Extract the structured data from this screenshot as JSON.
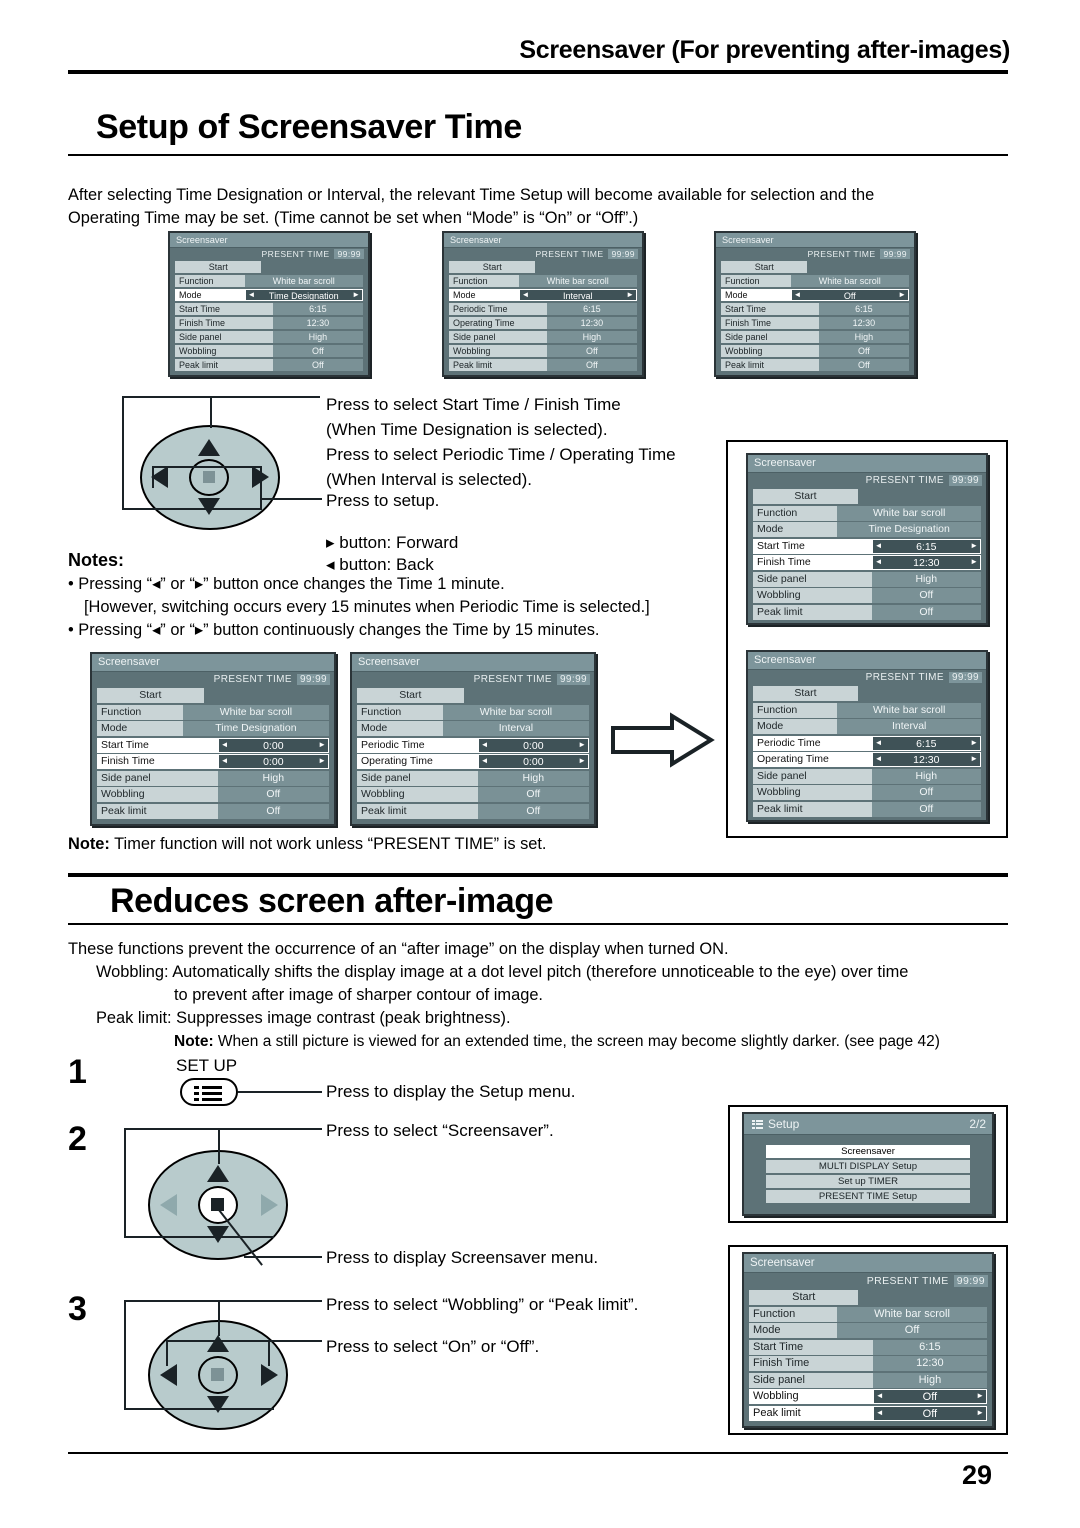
{
  "header": {
    "section_title": "Screensaver (For preventing after-images)",
    "h1": "Setup of Screensaver Time"
  },
  "intro": {
    "line1": "After selecting Time Designation or Interval, the relevant Time Setup will become available for selection and the",
    "line2": "Operating Time may be set. (Time cannot be set when “Mode” is “On” or “Off”.)"
  },
  "osd_common": {
    "title": "Screensaver",
    "present_time_label": "PRESENT TIME",
    "present_time_value": "99:99",
    "start_label": "Start",
    "function_label": "Function",
    "function_value": "White bar scroll",
    "mode_label": "Mode",
    "side_panel_label": "Side panel",
    "side_panel_value": "High",
    "wobbling_label": "Wobbling",
    "wobbling_value": "Off",
    "peak_limit_label": "Peak limit",
    "peak_limit_value": "Off",
    "start_time_label": "Start Time",
    "finish_time_label": "Finish Time",
    "periodic_time_label": "Periodic Time",
    "operating_time_label": "Operating Time",
    "arrow_left": "◄",
    "arrow_right": "►"
  },
  "panels": {
    "top1": {
      "mode_value": "Time Designation",
      "t1_label": "Start Time",
      "t1_value": "6:15",
      "t2_label": "Finish Time",
      "t2_value": "12:30"
    },
    "top2": {
      "mode_value": "Interval",
      "t1_label": "Periodic Time",
      "t1_value": "6:15",
      "t2_label": "Operating Time",
      "t2_value": "12:30"
    },
    "top3": {
      "mode_value": "Off",
      "t1_label": "Start Time",
      "t1_value": "6:15",
      "t2_label": "Finish Time",
      "t2_value": "12:30"
    },
    "right1": {
      "mode_value": "Time Designation",
      "t1_label": "Start Time",
      "t1_value": "6:15",
      "t2_label": "Finish Time",
      "t2_value": "12:30"
    },
    "right2": {
      "mode_value": "Interval",
      "t1_label": "Periodic Time",
      "t1_value": "6:15",
      "t2_label": "Operating Time",
      "t2_value": "12:30"
    },
    "bot1": {
      "mode_value": "Time Designation",
      "t1_label": "Start Time",
      "t1_value": "0:00",
      "t2_label": "Finish Time",
      "t2_value": "0:00"
    },
    "bot2": {
      "mode_value": "Interval",
      "t1_label": "Periodic Time",
      "t1_value": "0:00",
      "t2_label": "Operating Time",
      "t2_value": "0:00"
    },
    "final": {
      "mode_value": "Off",
      "t1_label": "Start Time",
      "t1_value": "6:15",
      "t2_label": "Finish Time",
      "t2_value": "12:30",
      "wobbling_value": "Off",
      "peak_limit_value": "Off"
    }
  },
  "setup_menu": {
    "title": "Setup",
    "page_indicator": "2/2",
    "items": [
      {
        "label": "Screensaver",
        "highlighted": true
      },
      {
        "label": "MULTI DISPLAY Setup",
        "highlighted": false
      },
      {
        "label": "Set up TIMER",
        "highlighted": false
      },
      {
        "label": "PRESENT TIME Setup",
        "highlighted": false
      }
    ]
  },
  "callouts": {
    "c1_l1": "Press to select Start Time / Finish Time",
    "c1_l2": "(When Time Designation is selected).",
    "c1_l3": "Press to select Periodic Time / Operating Time",
    "c1_l4": "(When Interval is selected).",
    "c2": "Press to setup.",
    "c3": "▸ button: Forward",
    "c4": "◂ button: Back"
  },
  "notes": {
    "heading": "Notes:",
    "n1": "• Pressing “◂” or “▸” button once changes the Time 1 minute.",
    "n2": "[However, switching occurs every 15 minutes when Periodic Time is selected.]",
    "n3": "• Pressing “◂” or “▸” button continuously changes the Time by 15 minutes.",
    "timer_note_bold": "Note:",
    "timer_note": " Timer function will not work unless “PRESENT TIME” is set."
  },
  "section2": {
    "h1": "Reduces screen after-image",
    "p1": "These functions prevent the occurrence of an “after image” on the display when turned ON.",
    "wobbling_term": "Wobbling:",
    "wobbling_l1": "Automatically shifts the display image at a dot level pitch (therefore unnoticeable to the eye) over time",
    "wobbling_l2": "to prevent after image of sharper contour of image.",
    "peak_term": "Peak limit:",
    "peak_l1": "Suppresses image contrast (peak brightness).",
    "note_bold": "Note:",
    "note_text": " When a still picture is viewed for an extended time, the screen may become slightly darker. (see page 42)"
  },
  "steps": {
    "s1_num": "1",
    "s1_btn_label": "SET UP",
    "s1_text": "Press to display the Setup menu.",
    "s2_num": "2",
    "s2_text_a": "Press to select “Screensaver”.",
    "s2_text_b": "Press to display Screensaver menu.",
    "s3_num": "3",
    "s3_text_a": "Press to select “Wobbling” or “Peak limit”.",
    "s3_text_b": "Press to select “On” or “Off”."
  },
  "footer": {
    "page_number": "29"
  }
}
